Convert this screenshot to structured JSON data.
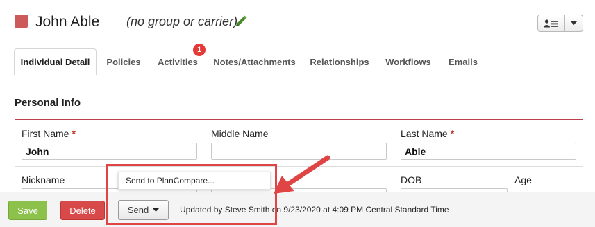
{
  "header": {
    "name": "John Able",
    "group_carrier": "(no group or carrier)",
    "swatch_color": "#cc5a5a"
  },
  "tabs": [
    {
      "label": "Individual Detail",
      "active": true
    },
    {
      "label": "Policies"
    },
    {
      "label": "Activities",
      "badge": "1"
    },
    {
      "label": "Notes/Attachments"
    },
    {
      "label": "Relationships"
    },
    {
      "label": "Workflows"
    },
    {
      "label": "Emails"
    }
  ],
  "section": {
    "title": "Personal Info"
  },
  "fields": {
    "first_name": {
      "label": "First Name",
      "required": "*",
      "value": "John"
    },
    "middle_name": {
      "label": "Middle Name",
      "value": ""
    },
    "last_name": {
      "label": "Last Name",
      "required": "*",
      "value": "Able"
    },
    "nickname": {
      "label": "Nickname"
    },
    "dob": {
      "label": "DOB"
    },
    "age": {
      "label": "Age"
    }
  },
  "footer": {
    "save_label": "Save",
    "delete_label": "Delete",
    "send_label": "Send",
    "updated_text": "Updated by Steve Smith on 9/23/2020 at 4:09 PM Central Standard Time"
  },
  "send_menu": {
    "items": [
      "Send to PlanCompare..."
    ]
  },
  "colors": {
    "accent_rule": "#b84048",
    "highlight": "#e04545",
    "save": "#8cc14c",
    "delete": "#d84a4a"
  }
}
